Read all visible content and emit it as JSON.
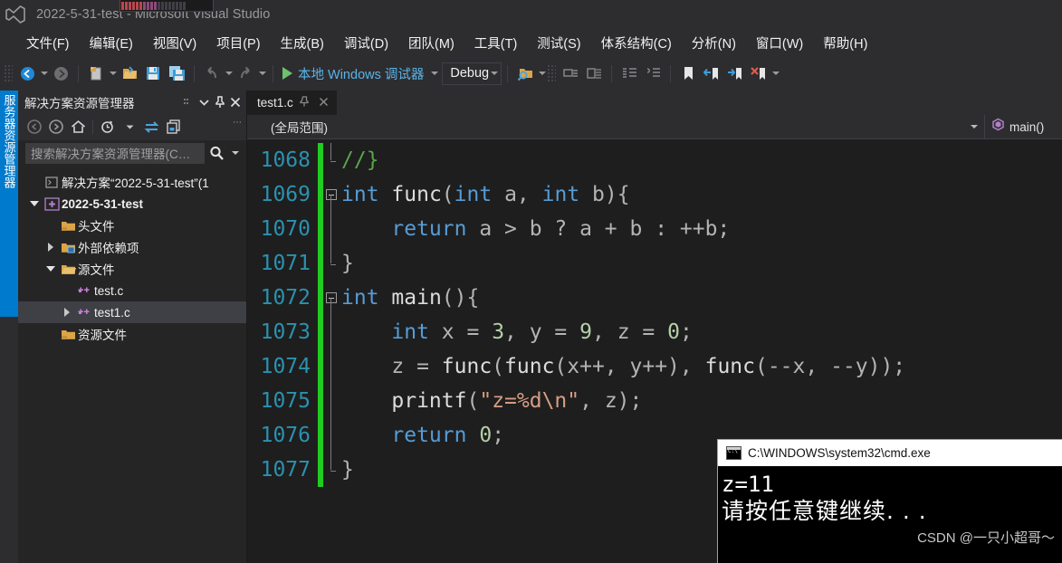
{
  "titlebar": {
    "title": "2022-5-31-test - Microsoft Visual Studio",
    "logo_icon": "visual-studio-logo-icon"
  },
  "menubar": {
    "items": [
      {
        "label": "文件(F)"
      },
      {
        "label": "编辑(E)"
      },
      {
        "label": "视图(V)"
      },
      {
        "label": "项目(P)"
      },
      {
        "label": "生成(B)"
      },
      {
        "label": "调试(D)"
      },
      {
        "label": "团队(M)"
      },
      {
        "label": "工具(T)"
      },
      {
        "label": "测试(S)"
      },
      {
        "label": "体系结构(C)"
      },
      {
        "label": "分析(N)"
      },
      {
        "label": "窗口(W)"
      },
      {
        "label": "帮助(H)"
      }
    ]
  },
  "toolbar": {
    "run_label": "本地 Windows 调试器",
    "config_label": "Debug",
    "icons": [
      "navigate-back-icon",
      "navigate-forward-icon",
      "new-item-icon",
      "open-file-icon",
      "save-icon",
      "save-all-icon",
      "undo-icon",
      "redo-icon",
      "find-in-files-icon",
      "comment-icon",
      "uncomment-icon",
      "indent-icon",
      "outdent-icon",
      "bookmark-icon",
      "previous-bookmark-icon",
      "next-bookmark-icon",
      "clear-bookmarks-icon"
    ]
  },
  "vertical_tab": {
    "label": "服务器资源管理器",
    "accent_color": "#007acc"
  },
  "solution_explorer": {
    "title": "解决方案资源管理器",
    "header_icons": [
      "more-options-icon",
      "window-dropdown-icon",
      "pin-icon",
      "close-icon"
    ],
    "toolbar_icons": [
      "back-icon",
      "forward-icon",
      "home-icon",
      "pending-changes-icon",
      "sync-with-active-document-icon",
      "show-all-files-icon",
      "overflow-icon"
    ],
    "search_placeholder": "搜索解决方案资源管理器(C…",
    "tree": [
      {
        "label": "解决方案“2022-5-31-test”(1",
        "icon": "solution-icon",
        "indent": 1,
        "twisty": "none",
        "bold": false,
        "selected": false
      },
      {
        "label": "2022-5-31-test",
        "icon": "cpp-project-icon",
        "indent": 1,
        "twisty": "expanded",
        "bold": true,
        "selected": false
      },
      {
        "label": "头文件",
        "icon": "folder-icon",
        "indent": 2,
        "twisty": "none",
        "bold": false,
        "selected": false
      },
      {
        "label": "外部依赖项",
        "icon": "external-dependencies-icon",
        "indent": 2,
        "twisty": "collapsed",
        "bold": false,
        "selected": false
      },
      {
        "label": "源文件",
        "icon": "open-folder-icon",
        "indent": 2,
        "twisty": "expanded",
        "bold": false,
        "selected": false
      },
      {
        "label": "test.c",
        "icon": "c-file-icon",
        "indent": 3,
        "twisty": "none",
        "bold": false,
        "selected": false
      },
      {
        "label": "test1.c",
        "icon": "c-file-icon",
        "indent": 3,
        "twisty": "collapsed",
        "bold": false,
        "selected": true
      },
      {
        "label": "资源文件",
        "icon": "folder-icon",
        "indent": 2,
        "twisty": "none",
        "bold": false,
        "selected": false
      }
    ]
  },
  "editor": {
    "tab_label": "test1.c",
    "tab_pin_icon": "pin-icon",
    "tab_close_icon": "close-icon",
    "scope_label": "(全局范围)",
    "member_label": "main()",
    "member_icon": "method-icon",
    "first_line_number": 1068,
    "lines": [
      {
        "n": "1068",
        "fold": "end",
        "change": true,
        "tokens": [
          {
            "t": "//}",
            "c": "cmt"
          }
        ]
      },
      {
        "n": "1069",
        "fold": "box",
        "change": true,
        "tokens": [
          {
            "t": "int",
            "c": "kw"
          },
          {
            "t": " ",
            "c": "plain"
          },
          {
            "t": "func",
            "c": "fn"
          },
          {
            "t": "(",
            "c": "plain"
          },
          {
            "t": "int",
            "c": "kw"
          },
          {
            "t": " ",
            "c": "plain"
          },
          {
            "t": "a",
            "c": "plain"
          },
          {
            "t": ", ",
            "c": "plain"
          },
          {
            "t": "int",
            "c": "kw"
          },
          {
            "t": " ",
            "c": "plain"
          },
          {
            "t": "b",
            "c": "plain"
          },
          {
            "t": "){",
            "c": "plain"
          }
        ]
      },
      {
        "n": "1070",
        "fold": "line",
        "change": true,
        "tokens": [
          {
            "t": "    ",
            "c": "plain"
          },
          {
            "t": "return",
            "c": "kw"
          },
          {
            "t": " a > b ? a + b : ++b;",
            "c": "plain"
          }
        ]
      },
      {
        "n": "1071",
        "fold": "endline",
        "change": true,
        "tokens": [
          {
            "t": "}",
            "c": "plain"
          }
        ]
      },
      {
        "n": "1072",
        "fold": "box",
        "change": true,
        "tokens": [
          {
            "t": "int",
            "c": "kw"
          },
          {
            "t": " ",
            "c": "plain"
          },
          {
            "t": "main",
            "c": "fn"
          },
          {
            "t": "(){",
            "c": "plain"
          }
        ]
      },
      {
        "n": "1073",
        "fold": "line",
        "change": true,
        "tokens": [
          {
            "t": "    ",
            "c": "plain"
          },
          {
            "t": "int",
            "c": "kw"
          },
          {
            "t": " x = ",
            "c": "plain"
          },
          {
            "t": "3",
            "c": "num"
          },
          {
            "t": ", y = ",
            "c": "plain"
          },
          {
            "t": "9",
            "c": "num"
          },
          {
            "t": ", z = ",
            "c": "plain"
          },
          {
            "t": "0",
            "c": "num"
          },
          {
            "t": ";",
            "c": "plain"
          }
        ]
      },
      {
        "n": "1074",
        "fold": "line",
        "change": true,
        "tokens": [
          {
            "t": "    z = ",
            "c": "plain"
          },
          {
            "t": "func",
            "c": "fn"
          },
          {
            "t": "(",
            "c": "plain"
          },
          {
            "t": "func",
            "c": "fn"
          },
          {
            "t": "(x++, y++), ",
            "c": "plain"
          },
          {
            "t": "func",
            "c": "fn"
          },
          {
            "t": "(--x, --y));",
            "c": "plain"
          }
        ]
      },
      {
        "n": "1075",
        "fold": "line",
        "change": true,
        "tokens": [
          {
            "t": "    ",
            "c": "plain"
          },
          {
            "t": "printf",
            "c": "fn"
          },
          {
            "t": "(",
            "c": "plain"
          },
          {
            "t": "\"z=%d\\n\"",
            "c": "str"
          },
          {
            "t": ", z);",
            "c": "plain"
          }
        ]
      },
      {
        "n": "1076",
        "fold": "line",
        "change": true,
        "tokens": [
          {
            "t": "    ",
            "c": "plain"
          },
          {
            "t": "return",
            "c": "kw"
          },
          {
            "t": " ",
            "c": "plain"
          },
          {
            "t": "0",
            "c": "num"
          },
          {
            "t": ";",
            "c": "plain"
          }
        ]
      },
      {
        "n": "1077",
        "fold": "endline",
        "change": true,
        "tokens": [
          {
            "t": "}",
            "c": "plain"
          }
        ]
      }
    ]
  },
  "console": {
    "title": "C:\\WINDOWS\\system32\\cmd.exe",
    "title_icon": "cmd-icon",
    "output_line1": "z=11",
    "output_line2": "请按任意键继续.  .  .",
    "watermark": "CSDN @一只小超哥～"
  },
  "colors": {
    "accent": "#007acc",
    "keyword": "#569cd6",
    "comment": "#57a64a",
    "number": "#b5cea8",
    "string": "#d69d85",
    "linenumber": "#2b91af",
    "changebar": "#20cc20",
    "editor_bg": "#1e1e1e",
    "chrome_bg": "#2d2d30"
  }
}
